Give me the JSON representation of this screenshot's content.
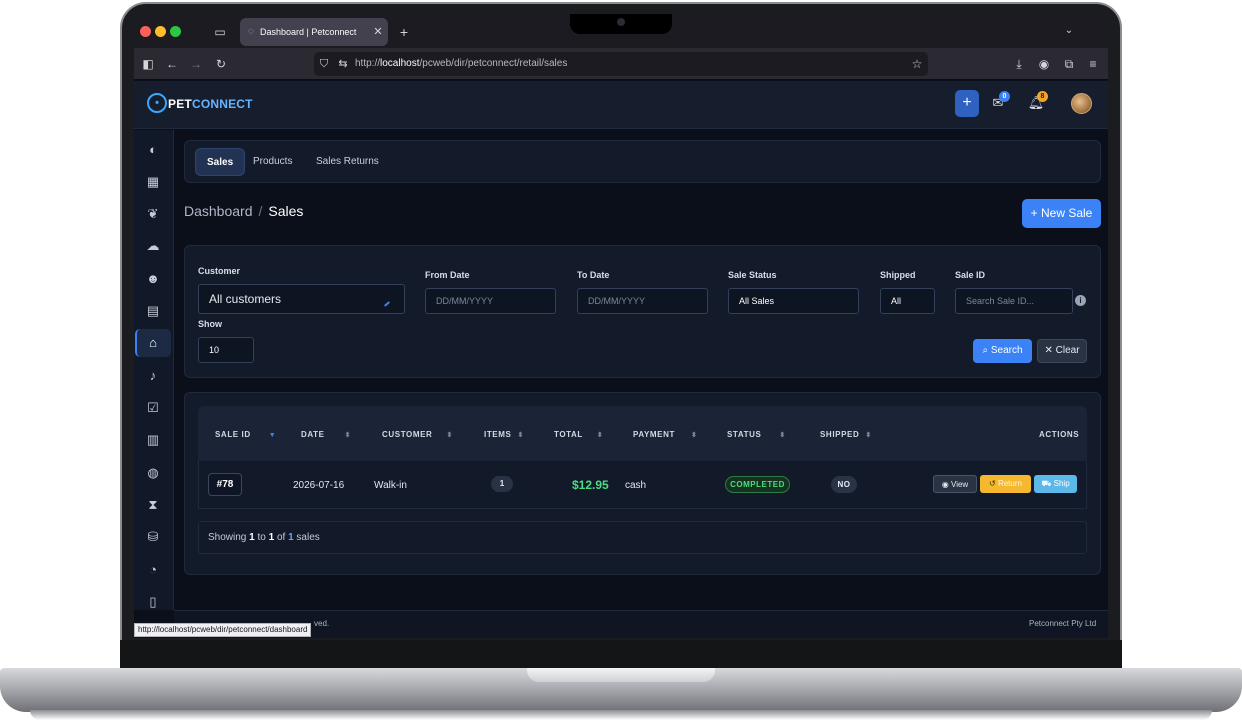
{
  "browser": {
    "tab_title": "Dashboard | Petconnect",
    "url_prefix": "http://",
    "url_host": "localhost",
    "url_path": "/pcweb/dir/petconnect/retail/sales",
    "status_url": "http://localhost/pcweb/dir/petconnect/dashboard",
    "traffic_light_colors": [
      "#ff5f57",
      "#febc2e",
      "#28c840"
    ]
  },
  "header": {
    "logo_part1": "PET",
    "logo_part2": "CONNECT",
    "messages_count": "0",
    "notifications_count": "8",
    "icons": [
      "plus-icon",
      "envelope-icon",
      "bell-icon",
      "avatar"
    ]
  },
  "sidebar": {
    "icons": [
      "gauge-icon",
      "calendar-icon",
      "paw-icon",
      "chat-icon",
      "users-icon",
      "book-icon",
      "store-icon",
      "bell-icon",
      "calendar-check-icon",
      "calendar-icon",
      "globe-icon",
      "hourglass-icon",
      "coins-icon",
      "pie-chart-icon",
      "file-icon"
    ],
    "active_index": 6
  },
  "subtabs": [
    "Sales",
    "Products",
    "Sales Returns"
  ],
  "breadcrumb": {
    "root": "Dashboard",
    "separator": "/",
    "current": "Sales"
  },
  "actions": {
    "new_sale": "New Sale",
    "search": "Search",
    "clear": "Clear"
  },
  "filters": {
    "customer_label": "Customer",
    "customer_value": "All customers",
    "from_date_label": "From Date",
    "from_date_placeholder": "DD/MM/YYYY",
    "to_date_label": "To Date",
    "to_date_placeholder": "DD/MM/YYYY",
    "sale_status_label": "Sale Status",
    "sale_status_value": "All Sales",
    "shipped_label": "Shipped",
    "shipped_value": "All",
    "sale_id_label": "Sale ID",
    "sale_id_placeholder": "Search Sale ID...",
    "show_label": "Show",
    "show_value": "10"
  },
  "table": {
    "headers": [
      "SALE ID",
      "DATE",
      "CUSTOMER",
      "ITEMS",
      "TOTAL",
      "PAYMENT",
      "STATUS",
      "SHIPPED",
      "ACTIONS"
    ],
    "rows": [
      {
        "sale_id": "#78",
        "date": "2026-07-16",
        "customer": "Walk-in",
        "items": "1",
        "total": "$12.95",
        "payment": "cash",
        "status": "COMPLETED",
        "shipped": "NO",
        "view": "View",
        "return": "Return",
        "ship": "Ship"
      }
    ],
    "showing": {
      "prefix": "Showing",
      "from": "1",
      "to_word": "to",
      "to": "1",
      "of_word": "of",
      "total": "1",
      "suffix": "sales"
    }
  },
  "footer": {
    "left_visible": "ved.",
    "right": "Petconnect Pty Ltd"
  },
  "colors": {
    "accent": "#3b82f6",
    "success": "#4ade80",
    "warning": "#f5b82e",
    "info": "#5bb8e8"
  }
}
